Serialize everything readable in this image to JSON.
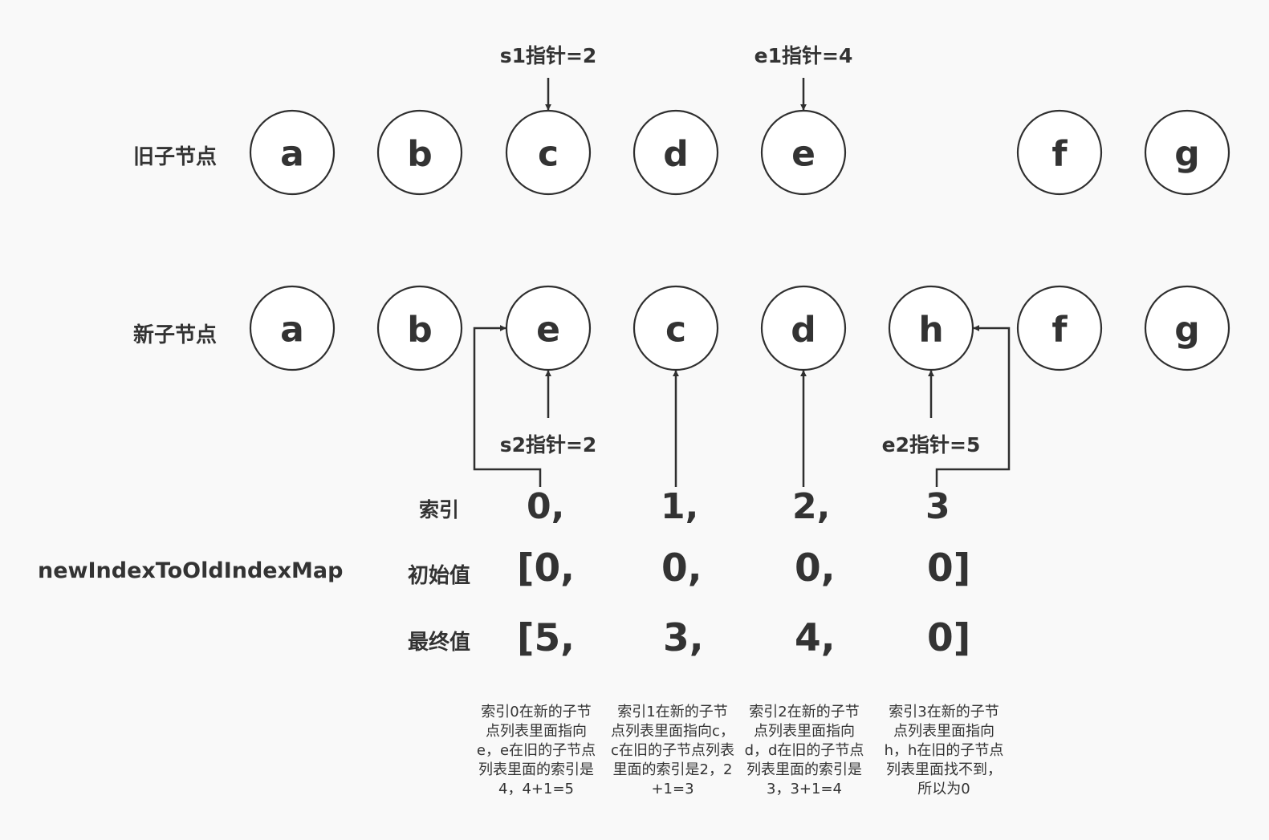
{
  "old_row": {
    "label": "旧子节点",
    "nodes": [
      "a",
      "b",
      "c",
      "d",
      "e",
      "f",
      "g"
    ]
  },
  "new_row": {
    "label": "新子节点",
    "nodes": [
      "a",
      "b",
      "e",
      "c",
      "d",
      "h",
      "f",
      "g"
    ]
  },
  "pointers": {
    "s1": "s1指针=2",
    "e1": "e1指针=4",
    "s2": "s2指针=2",
    "e2": "e2指针=5"
  },
  "map_label": "newIndexToOldIndexMap",
  "index_row": {
    "label": "索引",
    "values": [
      "0,",
      "1,",
      "2,",
      "3"
    ]
  },
  "initial_row": {
    "label": "初始值",
    "values": [
      "[0,",
      "0,",
      "0,",
      "0]"
    ]
  },
  "final_row": {
    "label": "最终值",
    "values": [
      "[5,",
      "3,",
      "4,",
      "0]"
    ]
  },
  "notes": [
    "索引0在新的子节点列表里面指向e，e在旧的子节点列表里面的索引是4，4+1=5",
    "索引1在新的子节点列表里面指向c，c在旧的子节点列表里面的索引是2，2+1=3",
    "索引2在新的子节点列表里面指向d，d在旧的子节点列表里面的索引是3，3+1=4",
    "索引3在新的子节点列表里面指向h，h在旧的子节点列表里面找不到，所以为0"
  ]
}
